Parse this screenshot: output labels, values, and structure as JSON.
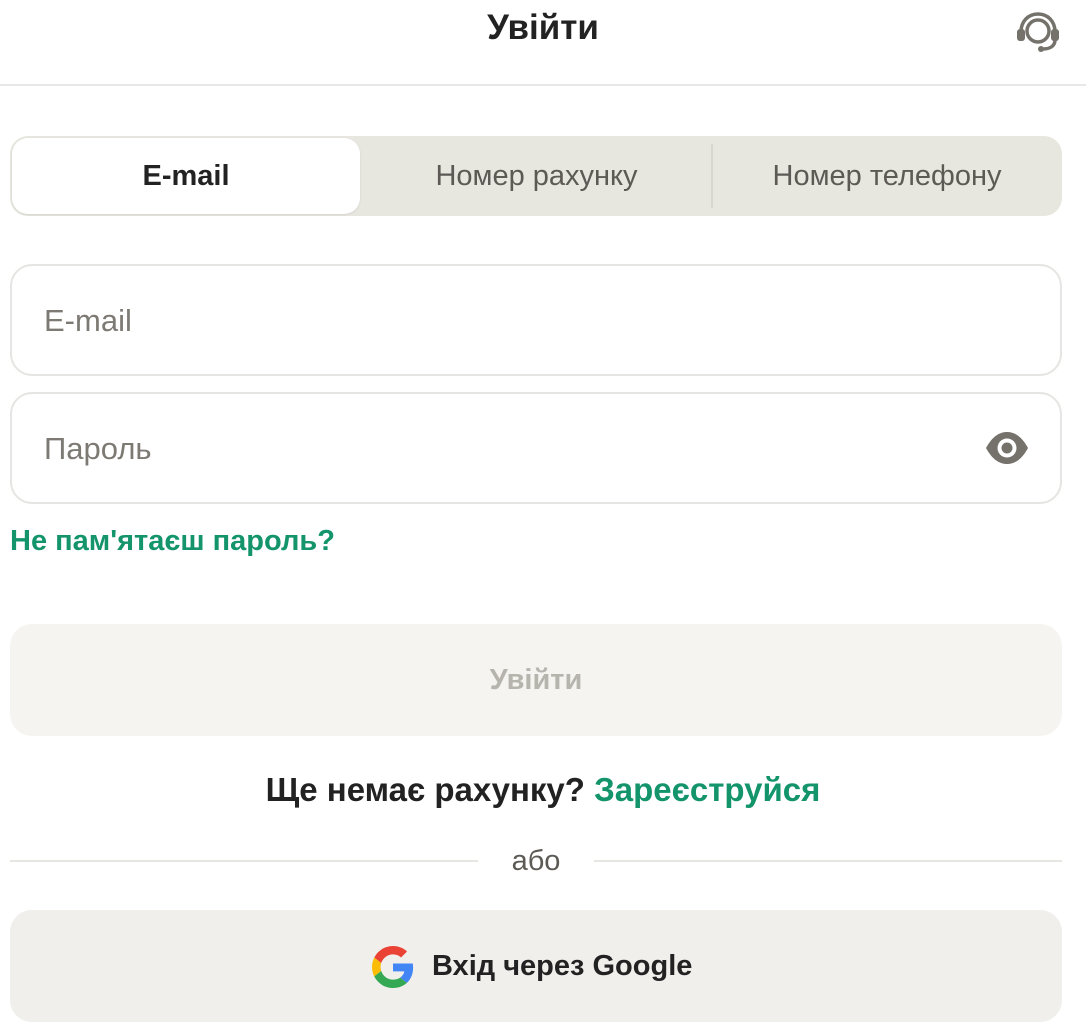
{
  "header": {
    "title": "Увійти",
    "support_icon": "headset-icon"
  },
  "tabs": [
    {
      "label": "E-mail",
      "active": true
    },
    {
      "label": "Номер рахунку",
      "active": false
    },
    {
      "label": "Номер телефону",
      "active": false
    }
  ],
  "form": {
    "email_placeholder": "E-mail",
    "email_value": "",
    "password_placeholder": "Пароль",
    "password_value": "",
    "password_toggle_icon": "eye-icon",
    "forgot_link": "Не пам'ятаєш пароль?",
    "submit_label": "Увійти",
    "submit_disabled": true
  },
  "register": {
    "question": "Ще немає рахунку?",
    "link": "Зареєструйся"
  },
  "divider": {
    "label": "або"
  },
  "social": {
    "google_label": "Вхід через Google",
    "google_icon": "google-logo-icon"
  },
  "colors": {
    "accent": "#14946b",
    "tab_background": "#e7e6df",
    "disabled_button_bg": "#f5f4f1",
    "disabled_button_text": "#b7b4ad"
  }
}
